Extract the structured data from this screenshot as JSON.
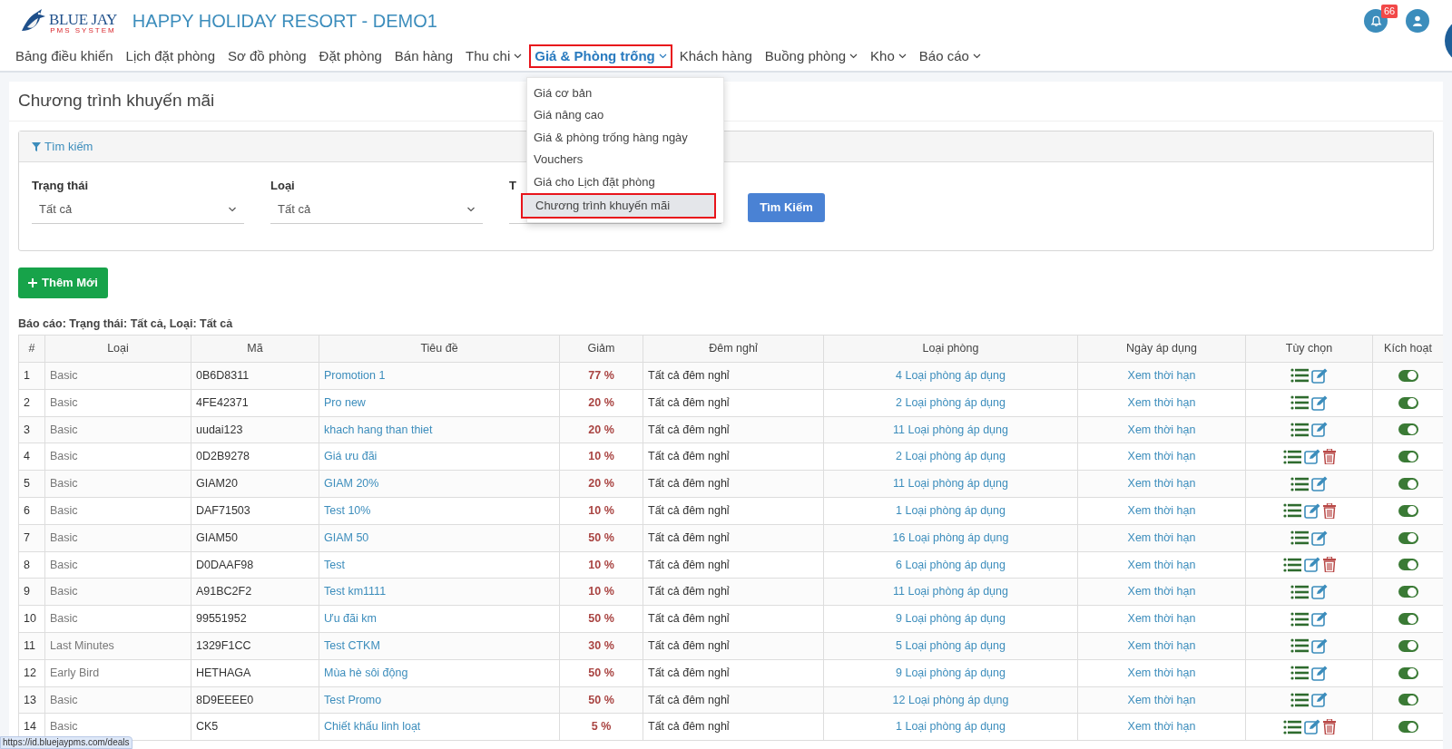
{
  "brand": {
    "logo_top": "BLUE JAY",
    "logo_bottom": "PMS SYSTEM",
    "title": "HAPPY HOLIDAY RESORT - DEMO1"
  },
  "notifications": {
    "count": "66"
  },
  "nav": [
    {
      "label": "Bảng điều khiển",
      "dropdown": false,
      "selected": false
    },
    {
      "label": "Lịch đặt phòng",
      "dropdown": false,
      "selected": false
    },
    {
      "label": "Sơ đồ phòng",
      "dropdown": false,
      "selected": false
    },
    {
      "label": "Đặt phòng",
      "dropdown": false,
      "selected": false
    },
    {
      "label": "Bán hàng",
      "dropdown": false,
      "selected": false
    },
    {
      "label": "Thu chi",
      "dropdown": true,
      "selected": false
    },
    {
      "label": "Giá & Phòng trống",
      "dropdown": true,
      "selected": true
    },
    {
      "label": "Khách hàng",
      "dropdown": false,
      "selected": false
    },
    {
      "label": "Buồng phòng",
      "dropdown": true,
      "selected": false
    },
    {
      "label": "Kho",
      "dropdown": true,
      "selected": false
    },
    {
      "label": "Báo cáo",
      "dropdown": true,
      "selected": false
    }
  ],
  "menu": [
    {
      "label": "Giá cơ bản",
      "selected": false
    },
    {
      "label": "Giá nâng cao",
      "selected": false
    },
    {
      "label": "Giá & phòng trống hàng ngày",
      "selected": false
    },
    {
      "label": "Vouchers",
      "selected": false
    },
    {
      "label": "Giá cho Lịch đặt phòng",
      "selected": false
    },
    {
      "label": "Chương trình khuyến mãi",
      "selected": true
    }
  ],
  "page_title": "Chương trình khuyến mãi",
  "search": {
    "title": "Tìm kiếm",
    "filters": [
      {
        "label": "Trạng thái",
        "value": "Tất cả"
      },
      {
        "label": "Loại",
        "value": "Tất cả"
      },
      {
        "label": "T"
      }
    ],
    "button": "Tìm Kiếm"
  },
  "add_button": "Thêm Mới",
  "status_url": "https://id.bluejaypms.com/deals",
  "report": "Báo cáo: Trạng thái: Tất cả, Loại: Tất cả",
  "table": {
    "columns": [
      "#",
      "Loại",
      "Mã",
      "Tiêu đề",
      "Giảm",
      "Đêm nghỉ",
      "Loại phòng",
      "Ngày áp dụng",
      "Tùy chọn",
      "Kích hoạt"
    ],
    "rows": [
      {
        "no": "1",
        "type": "Basic",
        "code": "0B6D8311",
        "title": "Promotion 1",
        "discount": "77 %",
        "nights": "Tất cả đêm nghỉ",
        "rooms": "4 Loại phòng áp dụng",
        "dates": "Xem thời hạn",
        "deletable": false,
        "active": true
      },
      {
        "no": "2",
        "type": "Basic",
        "code": "4FE42371",
        "title": "Pro new",
        "discount": "20 %",
        "nights": "Tất cả đêm nghỉ",
        "rooms": "2 Loại phòng áp dụng",
        "dates": "Xem thời hạn",
        "deletable": false,
        "active": true
      },
      {
        "no": "3",
        "type": "Basic",
        "code": "uudai123",
        "title": "khach hang than thiet",
        "discount": "20 %",
        "nights": "Tất cả đêm nghỉ",
        "rooms": "11 Loại phòng áp dụng",
        "dates": "Xem thời hạn",
        "deletable": false,
        "active": true
      },
      {
        "no": "4",
        "type": "Basic",
        "code": "0D2B9278",
        "title": "Giá ưu đãi",
        "discount": "10 %",
        "nights": "Tất cả đêm nghỉ",
        "rooms": "2 Loại phòng áp dụng",
        "dates": "Xem thời hạn",
        "deletable": true,
        "active": true
      },
      {
        "no": "5",
        "type": "Basic",
        "code": "GIAM20",
        "title": "GIAM 20%",
        "discount": "20 %",
        "nights": "Tất cả đêm nghỉ",
        "rooms": "11 Loại phòng áp dụng",
        "dates": "Xem thời hạn",
        "deletable": false,
        "active": true
      },
      {
        "no": "6",
        "type": "Basic",
        "code": "DAF71503",
        "title": "Test 10%",
        "discount": "10 %",
        "nights": "Tất cả đêm nghỉ",
        "rooms": "1 Loại phòng áp dụng",
        "dates": "Xem thời hạn",
        "deletable": true,
        "active": true
      },
      {
        "no": "7",
        "type": "Basic",
        "code": "GIAM50",
        "title": "GIAM 50",
        "discount": "50 %",
        "nights": "Tất cả đêm nghỉ",
        "rooms": "16 Loại phòng áp dụng",
        "dates": "Xem thời hạn",
        "deletable": false,
        "active": true
      },
      {
        "no": "8",
        "type": "Basic",
        "code": "D0DAAF98",
        "title": "Test",
        "discount": "10 %",
        "nights": "Tất cả đêm nghỉ",
        "rooms": "6 Loại phòng áp dụng",
        "dates": "Xem thời hạn",
        "deletable": true,
        "active": true
      },
      {
        "no": "9",
        "type": "Basic",
        "code": "A91BC2F2",
        "title": "Test km1111",
        "discount": "10 %",
        "nights": "Tất cả đêm nghỉ",
        "rooms": "11 Loại phòng áp dụng",
        "dates": "Xem thời hạn",
        "deletable": false,
        "active": true
      },
      {
        "no": "10",
        "type": "Basic",
        "code": "99551952",
        "title": "Ưu đãi km",
        "discount": "50 %",
        "nights": "Tất cả đêm nghỉ",
        "rooms": "9 Loại phòng áp dụng",
        "dates": "Xem thời hạn",
        "deletable": false,
        "active": true
      },
      {
        "no": "11",
        "type": "Last Minutes",
        "code": "1329F1CC",
        "title": "Test CTKM",
        "discount": "30 %",
        "nights": "Tất cả đêm nghỉ",
        "rooms": "5 Loại phòng áp dụng",
        "dates": "Xem thời hạn",
        "deletable": false,
        "active": true
      },
      {
        "no": "12",
        "type": "Early Bird",
        "code": "HETHAGA",
        "title": "Mùa hè sôi động",
        "discount": "50 %",
        "nights": "Tất cả đêm nghỉ",
        "rooms": "9 Loại phòng áp dụng",
        "dates": "Xem thời hạn",
        "deletable": false,
        "active": true
      },
      {
        "no": "13",
        "type": "Basic",
        "code": "8D9EEEE0",
        "title": "Test Promo",
        "discount": "50 %",
        "nights": "Tất cả đêm nghỉ",
        "rooms": "12 Loại phòng áp dụng",
        "dates": "Xem thời hạn",
        "deletable": false,
        "active": true
      },
      {
        "no": "14",
        "type": "Basic",
        "code": "CK5",
        "title": "Chiết khấu linh loạt",
        "discount": "5 %",
        "nights": "Tất cả đêm nghỉ",
        "rooms": "1 Loại phòng áp dụng",
        "dates": "Xem thời hạn",
        "deletable": true,
        "active": true
      }
    ]
  }
}
